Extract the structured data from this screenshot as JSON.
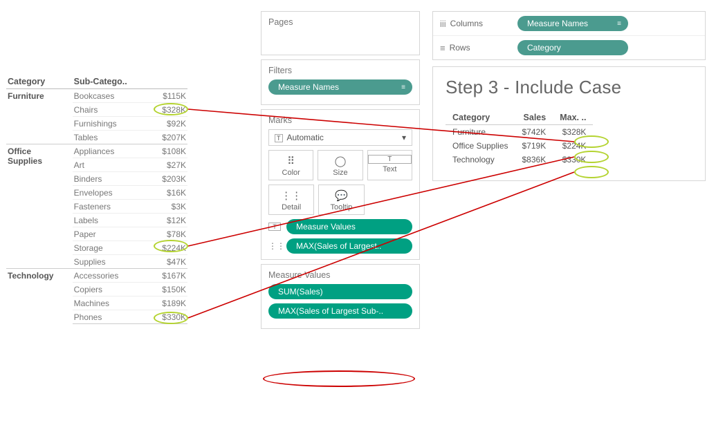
{
  "left_table": {
    "headers": {
      "category": "Category",
      "sub": "Sub-Catego..",
      "val": ""
    },
    "groups": [
      {
        "category": [
          "Furniture"
        ],
        "rows": [
          {
            "sub": "Bookcases",
            "val": "$115K"
          },
          {
            "sub": "Chairs",
            "val": "$328K"
          },
          {
            "sub": "Furnishings",
            "val": "$92K"
          },
          {
            "sub": "Tables",
            "val": "$207K"
          }
        ]
      },
      {
        "category": [
          "Office",
          "Supplies"
        ],
        "rows": [
          {
            "sub": "Appliances",
            "val": "$108K"
          },
          {
            "sub": "Art",
            "val": "$27K"
          },
          {
            "sub": "Binders",
            "val": "$203K"
          },
          {
            "sub": "Envelopes",
            "val": "$16K"
          },
          {
            "sub": "Fasteners",
            "val": "$3K"
          },
          {
            "sub": "Labels",
            "val": "$12K"
          },
          {
            "sub": "Paper",
            "val": "$78K"
          },
          {
            "sub": "Storage",
            "val": "$224K"
          },
          {
            "sub": "Supplies",
            "val": "$47K"
          }
        ]
      },
      {
        "category": [
          "Technology"
        ],
        "rows": [
          {
            "sub": "Accessories",
            "val": "$167K"
          },
          {
            "sub": "Copiers",
            "val": "$150K"
          },
          {
            "sub": "Machines",
            "val": "$189K"
          },
          {
            "sub": "Phones",
            "val": "$330K"
          }
        ]
      }
    ]
  },
  "cards": {
    "pages_title": "Pages",
    "filters_title": "Filters",
    "filters_pill": "Measure Names",
    "marks_title": "Marks",
    "marks_type_prefix": "T",
    "marks_type": "Automatic",
    "buttons": {
      "color": "Color",
      "size": "Size",
      "text": "Text",
      "detail": "Detail",
      "tooltip": "Tooltip"
    },
    "mark_pills": {
      "text": "Measure Values",
      "detail": "MAX(Sales of Largest.."
    },
    "measure_values_title": "Measure Values",
    "mv_pills": {
      "sum": "SUM(Sales)",
      "max": "MAX(Sales of Largest Sub-.."
    }
  },
  "shelves": {
    "columns_label": "Columns",
    "columns_pill": "Measure Names",
    "rows_label": "Rows",
    "rows_pill": "Category"
  },
  "result": {
    "title": "Step 3 - Include Case",
    "headers": {
      "category": "Category",
      "sales": "Sales",
      "max": "Max. .."
    },
    "rows": [
      {
        "cat": "Furniture",
        "sales": "$742K",
        "max": "$328K"
      },
      {
        "cat": "Office Supplies",
        "sales": "$719K",
        "max": "$224K"
      },
      {
        "cat": "Technology",
        "sales": "$836K",
        "max": "$330K"
      }
    ]
  }
}
